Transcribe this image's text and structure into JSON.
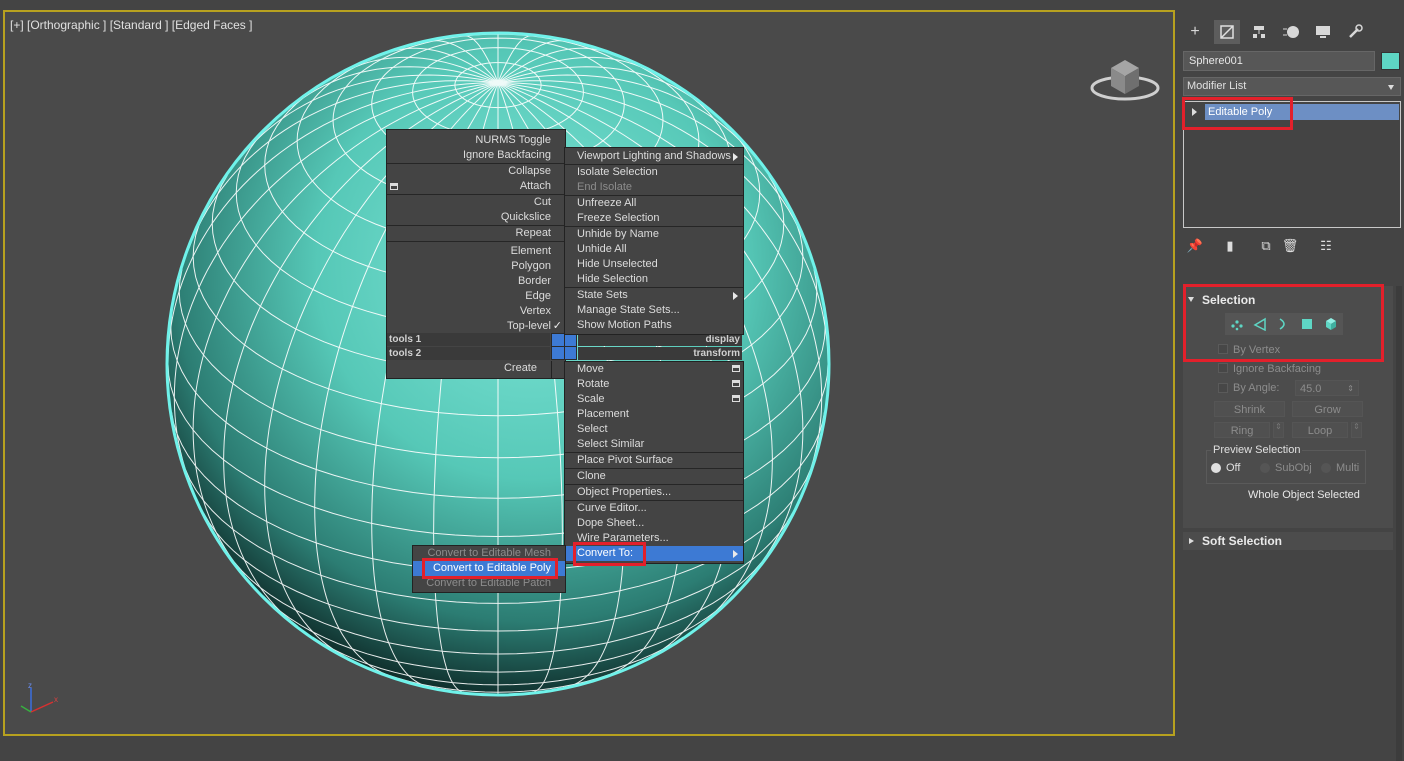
{
  "viewport": {
    "label": "[+] [Orthographic ] [Standard ] [Edged Faces ]",
    "object_color": "#5ed6c4",
    "border_color": "#b7a11f"
  },
  "quad_menu": {
    "left_items": [
      {
        "label": "NURMS Toggle"
      },
      {
        "label": "Ignore Backfacing"
      },
      {
        "label": "Collapse"
      },
      {
        "label": "Attach"
      },
      {
        "label": "Cut"
      },
      {
        "label": "Quickslice"
      },
      {
        "label": "Repeat"
      },
      {
        "label": "Element"
      },
      {
        "label": "Polygon"
      },
      {
        "label": "Border"
      },
      {
        "label": "Edge"
      },
      {
        "label": "Vertex"
      },
      {
        "label": "Top-level"
      }
    ],
    "quad_titles": {
      "tools1": "tools 1",
      "tools2": "tools 2",
      "display": "display",
      "transform": "transform"
    },
    "create_label": "Create",
    "right_items": [
      {
        "label": "Viewport Lighting and Shadows"
      },
      {
        "label": "Isolate Selection"
      },
      {
        "label": "End Isolate"
      },
      {
        "label": "Unfreeze All"
      },
      {
        "label": "Freeze Selection"
      },
      {
        "label": "Unhide by Name"
      },
      {
        "label": "Unhide All"
      },
      {
        "label": "Hide Unselected"
      },
      {
        "label": "Hide Selection"
      },
      {
        "label": "State Sets"
      },
      {
        "label": "Manage State Sets..."
      },
      {
        "label": "Show Motion Paths"
      }
    ],
    "transform_items": [
      {
        "label": "Move"
      },
      {
        "label": "Rotate"
      },
      {
        "label": "Scale"
      },
      {
        "label": "Placement"
      },
      {
        "label": "Select"
      },
      {
        "label": "Select Similar"
      },
      {
        "label": "Place Pivot Surface"
      },
      {
        "label": "Clone"
      },
      {
        "label": "Object Properties..."
      },
      {
        "label": "Curve Editor..."
      },
      {
        "label": "Dope Sheet..."
      },
      {
        "label": "Wire Parameters..."
      },
      {
        "label": "Convert To:"
      }
    ],
    "convert_submenu": [
      {
        "label": "Convert to Editable Mesh"
      },
      {
        "label": "Convert to Editable Poly"
      },
      {
        "label": "Convert to Editable Patch"
      }
    ]
  },
  "panel": {
    "tabs": [
      "create-icon",
      "modify-icon",
      "hierarchy-icon",
      "motion-icon",
      "display-icon",
      "utilities-icon"
    ],
    "object_name": "Sphere001",
    "modifier_list": "Modifier List",
    "stack_item": "Editable Poly",
    "selection": {
      "title": "Selection",
      "by_vertex": "By Vertex",
      "ignore_backfacing": "Ignore Backfacing",
      "by_angle": "By Angle:",
      "angle_value": "45.0",
      "shrink": "Shrink",
      "grow": "Grow",
      "ring": "Ring",
      "loop": "Loop",
      "preview_title": "Preview Selection",
      "off": "Off",
      "subobj": "SubObj",
      "multi": "Multi",
      "status": "Whole Object Selected"
    },
    "soft_selection": "Soft Selection"
  },
  "accent_colors": {
    "highlight": "#3d7ad4",
    "annotation": "#e3202b"
  }
}
